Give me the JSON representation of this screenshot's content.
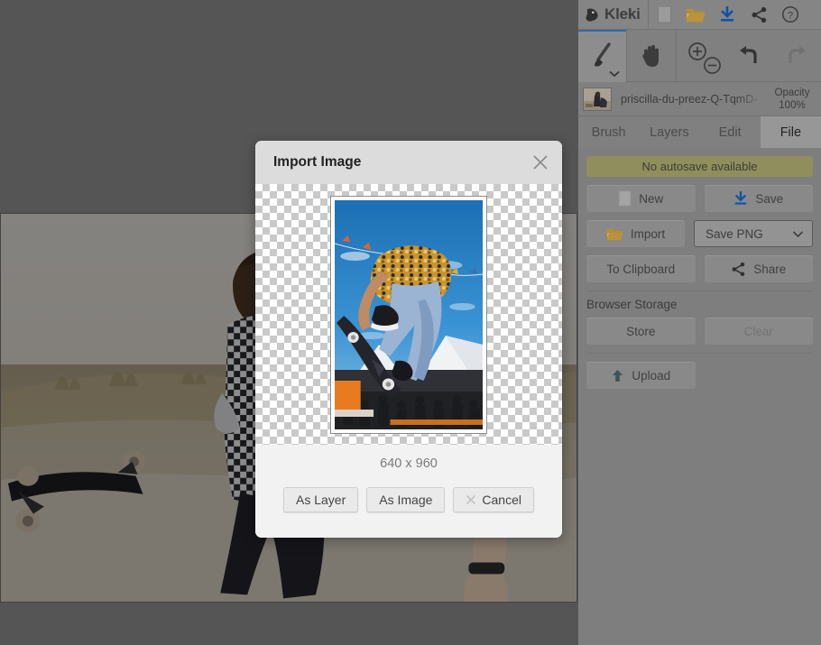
{
  "app": {
    "name": "Kleki",
    "logo_icon": "kleki-logo-icon"
  },
  "header": {
    "buttons": [
      {
        "label": "New",
        "icon": "page-icon"
      },
      {
        "label": "Import",
        "icon": "folder-open-icon"
      },
      {
        "label": "Save",
        "icon": "download-icon"
      },
      {
        "label": "Share",
        "icon": "share-icon"
      },
      {
        "label": "Help",
        "icon": "question-circle-icon"
      }
    ]
  },
  "toolbar": {
    "tools": [
      {
        "name": "brush",
        "icon": "paintbrush-icon",
        "active": true
      },
      {
        "name": "hand",
        "icon": "hand-icon",
        "active": false
      },
      {
        "name": "zoom",
        "icon": "zoom-in-out-icon",
        "active": false
      },
      {
        "name": "undo",
        "icon": "undo-icon",
        "active": false
      },
      {
        "name": "redo",
        "icon": "redo-icon",
        "active": false,
        "disabled": true
      }
    ]
  },
  "layer": {
    "name": "priscilla-du-preez-Q-TqmD-",
    "opacity_label": "Opacity",
    "opacity_value": "100%",
    "thumb_icon": "layer-thumbnail"
  },
  "tabs": [
    {
      "label": "Brush",
      "active": false
    },
    {
      "label": "Layers",
      "active": false
    },
    {
      "label": "Edit",
      "active": false
    },
    {
      "label": "File",
      "active": true
    }
  ],
  "file_panel": {
    "autosave_status": "No autosave available",
    "new_label": "New",
    "save_label": "Save",
    "import_label": "Import",
    "format_selected": "Save PNG",
    "to_clipboard_label": "To Clipboard",
    "share_label": "Share",
    "browser_storage_label": "Browser Storage",
    "store_label": "Store",
    "clear_label": "Clear",
    "upload_label": "Upload"
  },
  "modal": {
    "title": "Import Image",
    "close_icon": "close-icon",
    "dimensions": "640 x 960",
    "as_layer_label": "As Layer",
    "as_image_label": "As Image",
    "cancel_label": "Cancel",
    "cancel_icon": "close-icon"
  },
  "colors": {
    "accent_blue": "#3e7fd0",
    "autosave_bg": "#b0ae72",
    "panel_bg": "#9a9a9a",
    "modal_bg": "#f2f2f2",
    "overlay": "rgba(0,0,0,0.40)"
  }
}
